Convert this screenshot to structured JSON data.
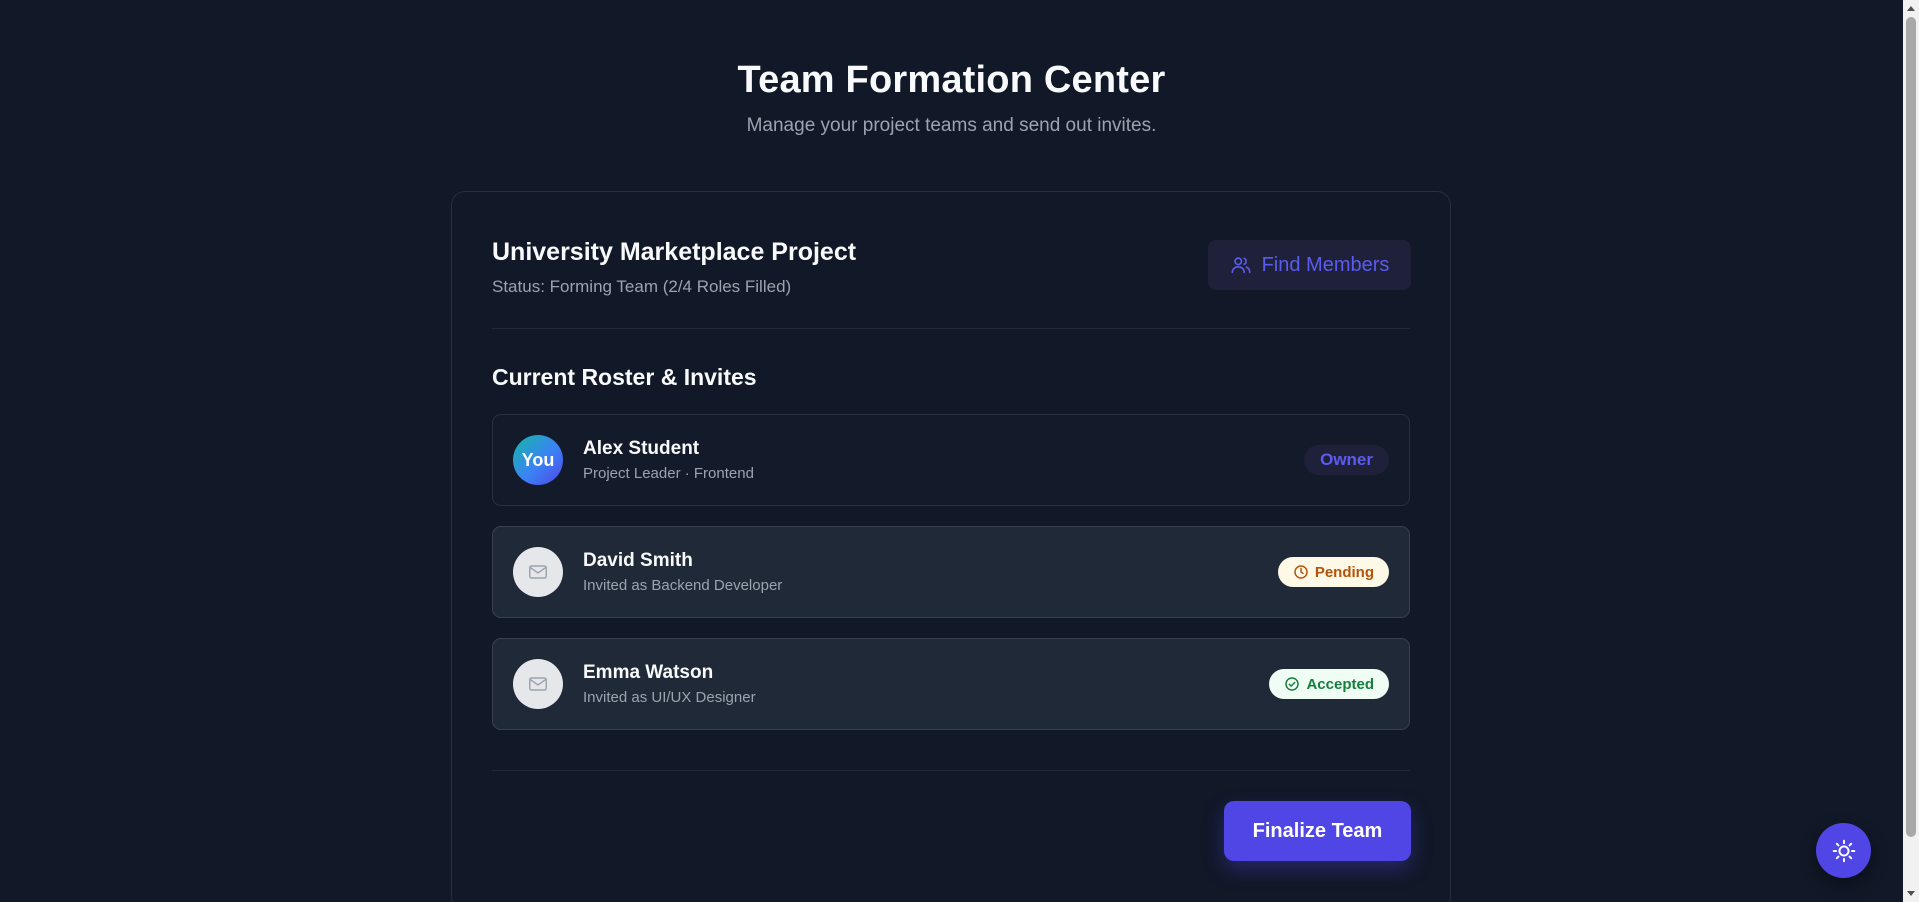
{
  "header": {
    "title": "Team Formation Center",
    "subtitle": "Manage your project teams and send out invites."
  },
  "project": {
    "title": "University Marketplace Project",
    "status": "Status: Forming Team (2/4 Roles Filled)",
    "find_members_label": "Find Members",
    "find_members_icon": "users-icon"
  },
  "roster": {
    "section_title": "Current Roster & Invites",
    "members": [
      {
        "avatar_text": "You",
        "name": "Alex Student",
        "role": "Project Leader · Frontend",
        "badge": "Owner"
      },
      {
        "avatar_icon": "mail-icon",
        "name": "David Smith",
        "role": "Invited as Backend Developer",
        "badge": "Pending",
        "badge_icon": "clock-icon"
      },
      {
        "avatar_icon": "mail-icon",
        "name": "Emma Watson",
        "role": "Invited as UI/UX Designer",
        "badge": "Accepted",
        "badge_icon": "check-circle-icon"
      }
    ]
  },
  "actions": {
    "finalize_label": "Finalize Team"
  },
  "theme_toggle": {
    "icon": "sun-icon"
  },
  "colors": {
    "background": "#111827",
    "accent": "#4f46e5",
    "accent_text": "#5b5bf0",
    "pending": "#b45309",
    "accepted": "#15803d"
  }
}
